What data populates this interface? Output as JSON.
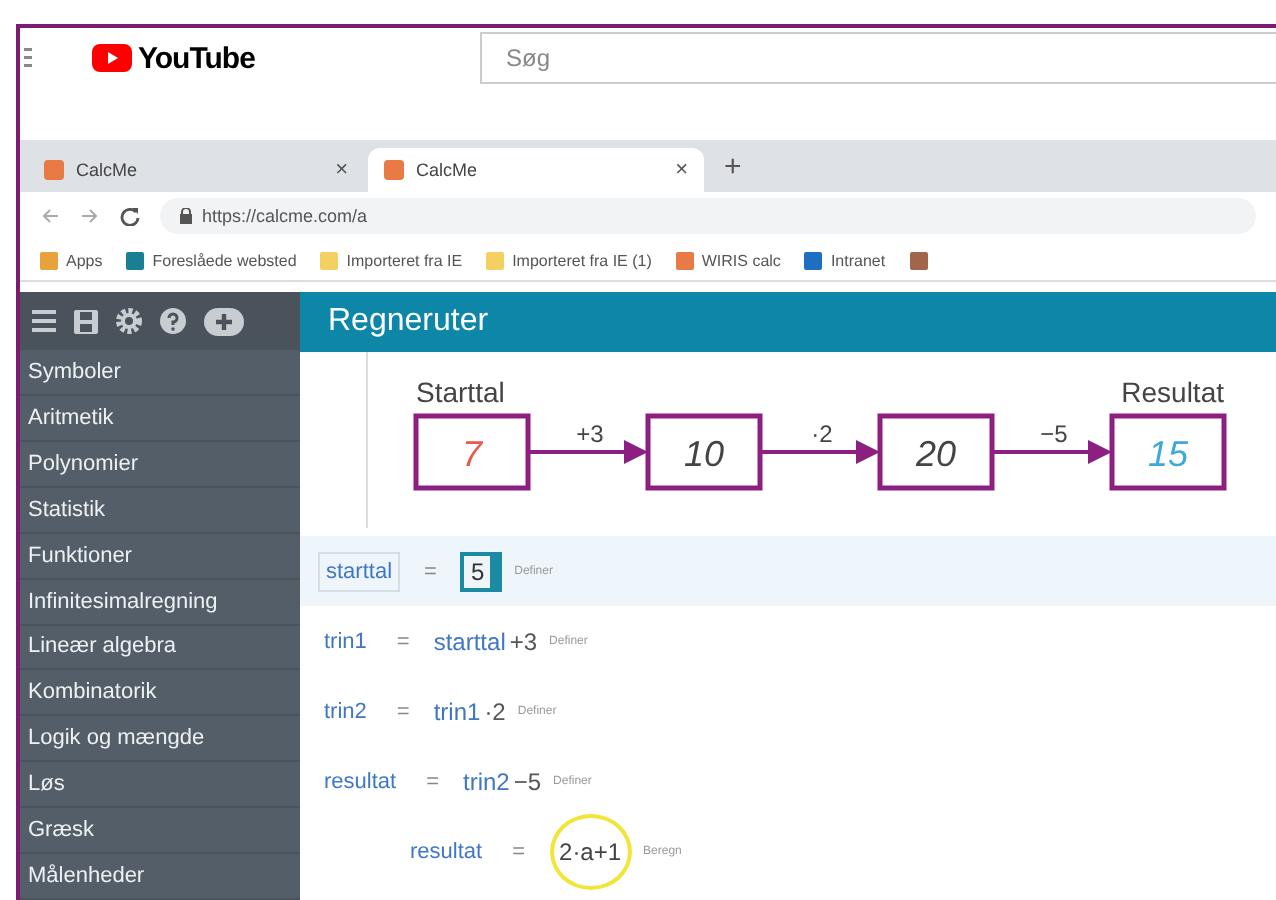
{
  "youtube": {
    "logo": "YouTube",
    "search": {
      "placeholder": "Søg"
    }
  },
  "browser": {
    "tabs": [
      {
        "title": "CalcMe",
        "selected": false
      },
      {
        "title": "CalcMe",
        "selected": true
      }
    ],
    "close": "×",
    "new_tab": "+",
    "url": "https://calcme.com/a",
    "bookmarks": [
      {
        "label": "Apps",
        "kind": "apps"
      },
      {
        "label": "Foreslåede websted",
        "kind": "bing"
      },
      {
        "label": "Importeret fra IE",
        "kind": "folder"
      },
      {
        "label": "Importeret fra IE (1)",
        "kind": "folder"
      },
      {
        "label": "WIRIS calc",
        "kind": "wiris"
      },
      {
        "label": "Intranet",
        "kind": "sharepoint"
      },
      {
        "kind": "grid"
      }
    ]
  },
  "sidebar": {
    "items": [
      "Symboler",
      "Aritmetik",
      "Polynomier",
      "Statistik",
      "Funktioner",
      "Infinitesimalregning",
      "Lineær algebra",
      "Kombinatorik",
      "Logik og mængde",
      "Løs",
      "Græsk",
      "Målenheder"
    ]
  },
  "header": {
    "title": "Regneruter"
  },
  "diagram": {
    "start_label": "Starttal",
    "end_label": "Resultat",
    "nodes": [
      {
        "value": "7",
        "color": "#e8584b"
      },
      {
        "value": "10",
        "color": "#444444"
      },
      {
        "value": "20",
        "color": "#444444"
      },
      {
        "value": "15",
        "color": "#3ea8dc"
      }
    ],
    "ops": [
      "+3",
      "·2",
      "−5"
    ]
  },
  "rows": [
    {
      "name": "starttal",
      "equals": "=",
      "selected": true,
      "indented": false,
      "action": "Definer",
      "expr": [
        {
          "kind": "input",
          "text": "5"
        }
      ]
    },
    {
      "name": "trin1",
      "equals": "=",
      "selected": false,
      "indented": false,
      "action": "Definer",
      "expr": [
        {
          "kind": "var",
          "text": "starttal"
        },
        {
          "kind": "num",
          "text": "+3"
        }
      ]
    },
    {
      "name": "trin2",
      "equals": "=",
      "selected": false,
      "indented": false,
      "action": "Definer",
      "expr": [
        {
          "kind": "var",
          "text": "trin1"
        },
        {
          "kind": "num",
          "text": "·2"
        }
      ]
    },
    {
      "name": "resultat",
      "equals": "=",
      "selected": false,
      "indented": false,
      "action": "Definer",
      "expr": [
        {
          "kind": "var",
          "text": "trin2"
        },
        {
          "kind": "num",
          "text": "−5"
        }
      ]
    },
    {
      "name": "resultat",
      "equals": "=",
      "selected": false,
      "indented": true,
      "action": "Beregn",
      "expr": [
        {
          "kind": "highlight",
          "text": "2·a+1"
        }
      ]
    }
  ]
}
